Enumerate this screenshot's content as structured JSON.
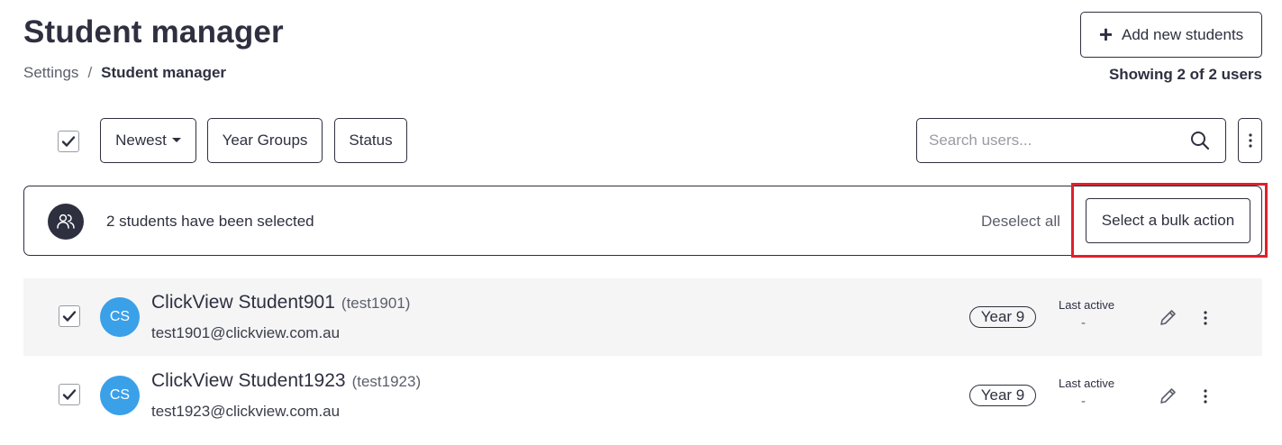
{
  "header": {
    "title": "Student manager",
    "add_button_label": "Add new students",
    "showing_text": "Showing 2 of 2 users"
  },
  "breadcrumb": {
    "items": [
      "Settings",
      "Student manager"
    ],
    "separator": "/"
  },
  "toolbar": {
    "sort_label": "Newest",
    "year_groups_label": "Year Groups",
    "status_label": "Status",
    "search_placeholder": "Search users...",
    "search_value": "",
    "select_all_checked": true
  },
  "bulk_bar": {
    "message": "2 students have been selected",
    "deselect_label": "Deselect all",
    "action_label": "Select a bulk action",
    "highlight_color": "#e0202a"
  },
  "students": [
    {
      "initials": "CS",
      "name": "ClickView Student901",
      "username": "(test1901)",
      "email": "test1901@clickview.com.au",
      "year": "Year 9",
      "last_active_label": "Last active",
      "last_active_value": "-",
      "checked": true
    },
    {
      "initials": "CS",
      "name": "ClickView Student1923",
      "username": "(test1923)",
      "email": "test1923@clickview.com.au",
      "year": "Year 9",
      "last_active_label": "Last active",
      "last_active_value": "-",
      "checked": true
    }
  ],
  "colors": {
    "avatar": "#3aa0e8",
    "text_dark": "#2e3040",
    "row_shade": "#f5f5f6"
  }
}
